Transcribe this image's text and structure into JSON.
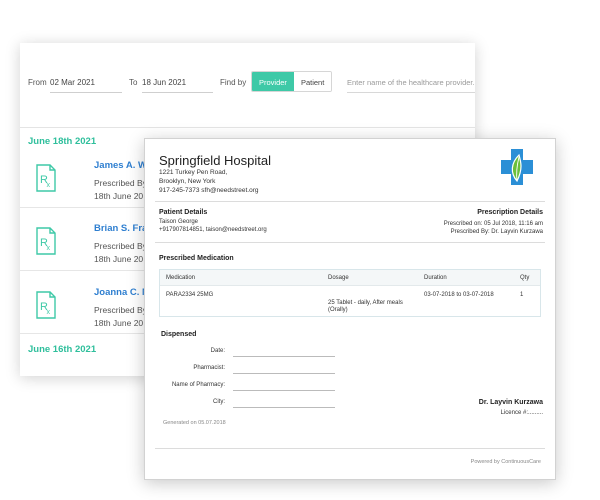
{
  "filters": {
    "from_label": "From",
    "from_value": "02 Mar 2021",
    "to_label": "To",
    "to_value": "18 Jun 2021",
    "find_by_label": "Find by",
    "provider_label": "Provider",
    "patient_label": "Patient",
    "search_placeholder": "Enter name of the healthcare provider..."
  },
  "groups": [
    {
      "date": "June 18th 2021",
      "items": [
        {
          "name": "James A. Wa",
          "prescribed_by": "Prescribed By",
          "date": "18th June 20"
        },
        {
          "name": "Brian S. Fran",
          "prescribed_by": "Prescribed By",
          "date": "18th June 20"
        },
        {
          "name": "Joanna C. Me",
          "prescribed_by": "Prescribed By",
          "date": "18th June 20"
        }
      ]
    },
    {
      "date": "June 16th 2021",
      "items": []
    }
  ],
  "prescription": {
    "hospital_name": "Springfield Hospital",
    "address_line1": "1221 Turkey Pen Road,",
    "address_line2": "Brooklyn, New York",
    "contact": "917-245-7373   sfh@needstreet.org",
    "patient_details_title": "Patient Details",
    "patient_name": "Taison George",
    "patient_contact": "+917907814851, taison@needstreet.org",
    "prescription_details_title": "Prescription Details",
    "prescribed_on": "Prescribed on: 05 Jul 2018, 11:16 am",
    "prescribed_by": "Prescribed By: Dr. Layvin Kurzawa",
    "prescribed_medication_title": "Prescribed Medication",
    "table": {
      "headers": [
        "Medication",
        "Dosage",
        "Duration",
        "Qty"
      ],
      "row": {
        "medication": "PARA2334 25MG",
        "dosage_line1": "25 Tablet - daily, After meals",
        "dosage_line2": "(Orally)",
        "duration": "03-07-2018 to 03-07-2018",
        "qty": "1"
      }
    },
    "dispensed_title": "Dispensed",
    "dispensed_fields": [
      "Date:",
      "Pharmacist:",
      "Name of Pharmacy:",
      "City:"
    ],
    "doctor_name": "Dr. Layvin Kurzawa",
    "licence": "Licence #:.........",
    "generated_on": "Generated on 05.07.2018",
    "powered_by": "Powered by ContinuousCare"
  },
  "colors": {
    "accent_green": "#3ec9a7",
    "link_blue": "#2f7fd0",
    "logo_blue": "#2b8fd6",
    "logo_green": "#6bbf3b"
  }
}
